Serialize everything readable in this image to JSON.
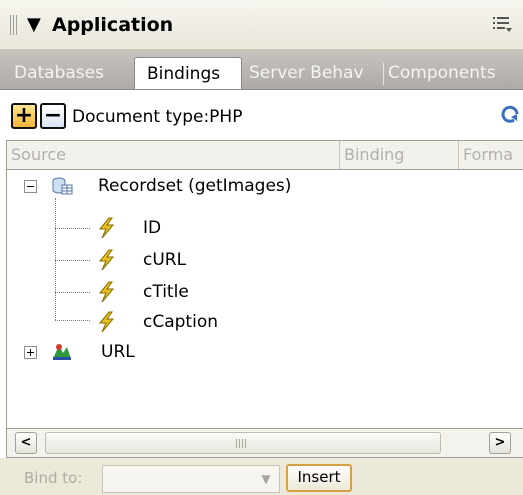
{
  "panel": {
    "title": "Application",
    "collapse_glyph": "▼",
    "menu_icon": "options-menu-icon"
  },
  "tabs": [
    {
      "label": "Databases",
      "active": false
    },
    {
      "label": "Bindings",
      "active": true
    },
    {
      "label": "Server Behav",
      "active": false
    },
    {
      "label": "Components",
      "active": false
    }
  ],
  "toolbar": {
    "add_label": "+",
    "remove_label": "−",
    "document_type": "Document type:PHP",
    "refresh_icon": "refresh-icon"
  },
  "columns": [
    "Source",
    "Binding",
    "Forma"
  ],
  "tree": {
    "recordset": {
      "label": "Recordset (getImages)",
      "expanded": true,
      "fields": [
        "ID",
        "cURL",
        "cTitle",
        "cCaption"
      ]
    },
    "url": {
      "label": "URL",
      "expanded": false
    }
  },
  "scrollbar": {
    "left_arrow": "<",
    "right_arrow": ">"
  },
  "bindbar": {
    "bind_to_label": "Bind to:",
    "select_value": "",
    "insert_label": "Insert"
  },
  "colors": {
    "accent_yellow": "#f3b53a",
    "tab_bar": "#b8b5b1",
    "bolt": "#e8c21c"
  }
}
